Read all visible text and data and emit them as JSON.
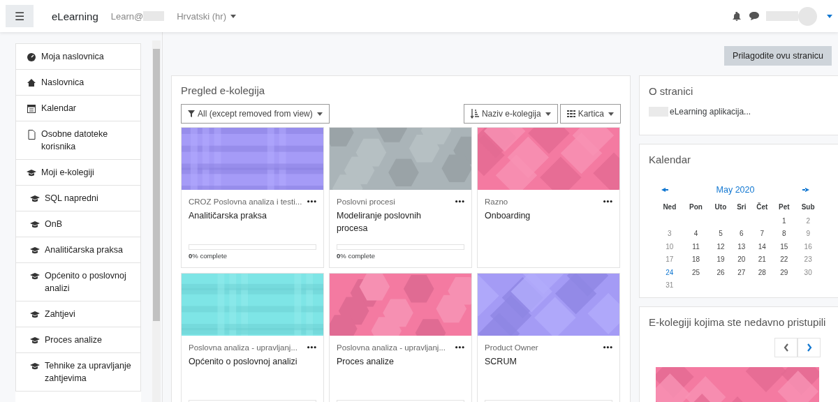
{
  "navbar": {
    "menu_button": "☰",
    "brand": "eLearning",
    "site_link": "Learn@",
    "language": "Hrvatski (hr)"
  },
  "sidebar": {
    "items": [
      {
        "label": "Moja naslovnica",
        "kind": "dashboard"
      },
      {
        "label": "Naslovnica",
        "kind": "home"
      },
      {
        "label": "Kalendar",
        "kind": "calendar"
      },
      {
        "label": "Osobne datoteke korisnika",
        "kind": "file"
      },
      {
        "label": "Moji e-kolegiji",
        "kind": "course",
        "children": [
          {
            "label": "SQL napredni",
            "kind": "course"
          },
          {
            "label": "OnB",
            "kind": "course"
          },
          {
            "label": "Analitičarska praksa",
            "kind": "course"
          },
          {
            "label": "Općenito o poslovnoj analizi",
            "kind": "course"
          },
          {
            "label": "Zahtjevi",
            "kind": "course"
          },
          {
            "label": "Proces analize",
            "kind": "course"
          },
          {
            "label": "Tehnike za upravljanje zahtjevima",
            "kind": "course"
          }
        ]
      }
    ]
  },
  "customize_button": "Prilagodite ovu stranicu",
  "course_overview": {
    "title": "Pregled e-kolegija",
    "filter": "All (except removed from view)",
    "sort": "Naziv e-kolegija",
    "view": "Kartica",
    "courses": [
      {
        "category": "CROZ Poslovna analiza i testi...",
        "name": "Analitičarska praksa",
        "menu": "•••",
        "progress": {
          "level": 0,
          "text": "**0**% complete"
        }
      },
      {
        "category": "Poslovni procesi",
        "name": "Modeliranje poslovnih procesa",
        "menu": "•••",
        "progress": {
          "level": 0,
          "text": "**0**% complete"
        }
      },
      {
        "category": "Razno",
        "name": "Onboarding",
        "menu": "•••"
      },
      {
        "category": "Poslovna analiza - upravljanj...",
        "name": "Općenito o poslovnoj analizi",
        "menu": "•••",
        "progress": {
          "level": 0
        }
      },
      {
        "category": "Poslovna analiza - upravljanj...",
        "name": "Proces analize",
        "menu": "•••",
        "progress": {
          "level": 0
        }
      },
      {
        "category": "Product Owner",
        "name": "SCRUM",
        "menu": "•••",
        "progress": {
          "level": 0
        }
      }
    ]
  },
  "about": {
    "title": "O stranici",
    "text": "eLearning aplikacija..."
  },
  "calendar": {
    "title": "Kalendar",
    "month": "May 2020",
    "weekdays": [
      "Ned",
      "Pon",
      "Uto",
      "Sri",
      "Čet",
      "Pet",
      "Sub"
    ],
    "weeks": [
      [
        {
          "day": "1",
          "today": false
        },
        {
          "day": "2",
          "today": false
        }
      ],
      [
        {
          "day": "3",
          "today": false
        },
        {
          "day": "4",
          "today": false
        },
        {
          "day": "5",
          "today": false
        },
        {
          "day": "6",
          "today": false
        },
        {
          "day": "7",
          "today": false
        },
        {
          "day": "8",
          "today": false
        },
        {
          "day": "9",
          "today": false
        }
      ],
      [
        {
          "day": "10",
          "today": false
        },
        {
          "day": "11",
          "today": false
        },
        {
          "day": "12",
          "today": false
        },
        {
          "day": "13",
          "today": false
        },
        {
          "day": "14",
          "today": false
        },
        {
          "day": "15",
          "today": false
        },
        {
          "day": "16",
          "today": false
        }
      ],
      [
        {
          "day": "17",
          "today": false
        },
        {
          "day": "18",
          "today": false
        },
        {
          "day": "19",
          "today": false
        },
        {
          "day": "20",
          "today": false
        },
        {
          "day": "21",
          "today": false
        },
        {
          "day": "22",
          "today": false
        },
        {
          "day": "23",
          "today": false
        }
      ],
      [
        {
          "day": "24",
          "today": true
        },
        {
          "day": "25",
          "today": false
        },
        {
          "day": "26",
          "today": false
        },
        {
          "day": "27",
          "today": false
        },
        {
          "day": "28",
          "today": false
        },
        {
          "day": "29",
          "today": false
        },
        {
          "day": "30",
          "today": false
        }
      ],
      [
        {
          "day": "31",
          "today": false
        }
      ]
    ]
  },
  "recent": {
    "title": "E-kolegiji kojima ste nedavno pristupili",
    "prev_disabled": true
  }
}
